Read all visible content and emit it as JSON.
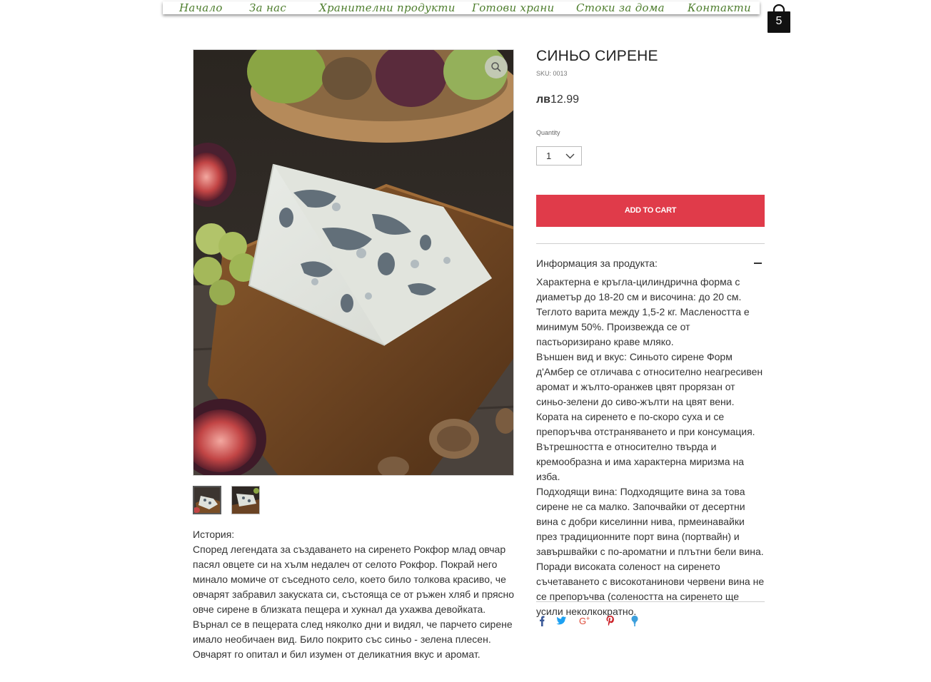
{
  "nav": {
    "items": [
      {
        "label": "Начало"
      },
      {
        "label": "За нас"
      },
      {
        "label": "Хранителни продукти"
      },
      {
        "label": "Готови храни"
      },
      {
        "label": "Стоки за дома"
      },
      {
        "label": "Контакти"
      }
    ],
    "color": "#4d7d2c"
  },
  "cart": {
    "count": "5",
    "icon": "shopping-bag-icon"
  },
  "product": {
    "title": "СИНЬО СИРЕНЕ",
    "sku": "SKU: 0013",
    "price_currency": "лв",
    "price_amount": "12.99",
    "quantity_label": "Quantity",
    "quantity_value": "1",
    "add_to_cart": "ADD TO CART",
    "add_to_cart_color": "#e03b4a",
    "info_title": "Информация за продукта:",
    "description": [
      "Характерна е  кръгла-цилиндрична форма с диаметър  до 18-20 см и височина: до 20 см. Теглото варита между 1,5-2 кг. Маслеността е минимум 50%. Произвежда се от  пастьоризирано краве мляко.",
      "Външен вид и вкус: Синьото сирене Форм д'Амбер се отличава с относително неагресивен  аромат и жълто-оранжев цвят прорязан от синьо-зелени до сиво-жълти на цвят вени. Кората на сиренето е по-скоро суха и се препоръчва отстраняването и при консумация. Вътрешността е относително твърда и кремообразна и има характерна миризма на изба.",
      "Подходящи вина: Подходящите вина за това сирене не са малко. Започвайки от десертни вина с добри киселинни нива, прмеинавайки през традиционните порт вина (портвайн) и завършвайки с  по-ароматни и плътни бели вина. Поради високата  соленост на сиренето съчетаването с  високотанинови червени вина не се препоръчва (солеността на сиренето ще усили неколкократно."
    ]
  },
  "history": {
    "heading": "История:",
    "text": "Според легендата за създаването на сиренето Рокфор млад овчар пасял овцете си на хълм недалеч от селото Рокфор. Покрай него минало момиче от съседното село, което било толкова красиво, че овчарят забравил закуската си, състояща се от ръжен хляб и прясно овче сирене в близката пещера и хукнал да ухажва девойката. Върнал се в пещерата след няколко дни и видял, че парчето сирене имало необичаен вид. Било покрито със синьо - зелена плесен. Овчарят го опитал и бил изумен от деликатния вкус и аромат."
  },
  "gallery": {
    "thumbnails": [
      {
        "icon": "cheese-thumbnail-1"
      },
      {
        "icon": "cheese-thumbnail-2"
      }
    ],
    "zoom_icon": "magnifier-icon"
  },
  "share": {
    "icons": [
      "facebook-icon",
      "twitter-icon",
      "google-plus-icon",
      "pinterest-icon",
      "fancy-icon"
    ],
    "colors": {
      "facebook": "#3b5998",
      "twitter": "#1da1f2",
      "google": "#dd4b39",
      "pinterest": "#cb2027",
      "fancy": "#3d9fdc"
    }
  }
}
